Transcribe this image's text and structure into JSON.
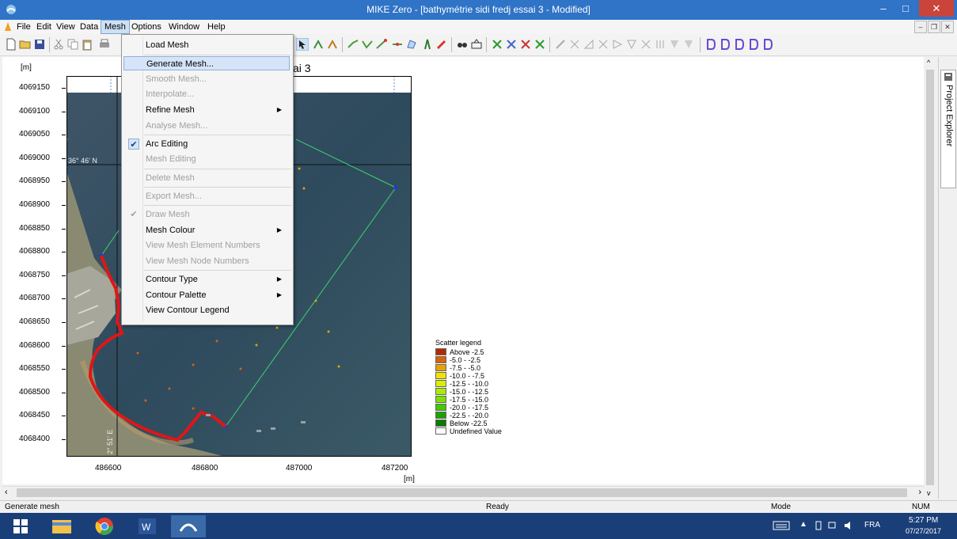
{
  "window": {
    "title": "MIKE Zero - [bathymétrie sidi fredj essai 3 - Modified]",
    "controls": {
      "minimize": "–",
      "maximize": "□",
      "close": "✕"
    }
  },
  "menubar": {
    "items": [
      "File",
      "Edit",
      "View",
      "Data",
      "Mesh",
      "Options",
      "Window",
      "Help"
    ],
    "active": "Mesh",
    "mdi": {
      "minimize": "–",
      "restore": "❐",
      "close": "✕"
    }
  },
  "mesh_menu": {
    "items": [
      {
        "label": "Load Mesh",
        "enabled": true
      },
      {
        "label": "Generate Mesh...",
        "enabled": true,
        "highlighted": true
      },
      {
        "label": "Smooth Mesh...",
        "enabled": false
      },
      {
        "label": "Interpolate...",
        "enabled": false
      },
      {
        "label": "Refine Mesh",
        "enabled": true,
        "submenu": true
      },
      {
        "label": "Analyse Mesh...",
        "enabled": false
      },
      {
        "label": "Arc Editing",
        "enabled": true,
        "checked": true
      },
      {
        "label": "Mesh Editing",
        "enabled": false
      },
      {
        "label": "Delete Mesh",
        "enabled": false
      },
      {
        "label": "Export Mesh...",
        "enabled": false
      },
      {
        "label": "Draw Mesh",
        "enabled": false,
        "checked": true
      },
      {
        "label": "Mesh Colour",
        "enabled": true,
        "submenu": true
      },
      {
        "label": "View Mesh Element Numbers",
        "enabled": false
      },
      {
        "label": "View Mesh Node Numbers",
        "enabled": false
      },
      {
        "label": "Contour Type",
        "enabled": true,
        "submenu": true
      },
      {
        "label": "Contour Palette",
        "enabled": true,
        "submenu": true
      },
      {
        "label": "View Contour Legend",
        "enabled": true
      }
    ]
  },
  "plot": {
    "title_fragment": "ai 3",
    "y_unit": "[m]",
    "x_unit": "[m]",
    "y_ticks": [
      "4069150",
      "4069100",
      "4069050",
      "4069000",
      "4068950",
      "4068900",
      "4068850",
      "4068800",
      "4068750",
      "4068700",
      "4068650",
      "4068600",
      "4068550",
      "4068500",
      "4068450",
      "4068400"
    ],
    "x_ticks": [
      "486600",
      "486800",
      "487000",
      "487200"
    ],
    "lat_label": "36° 46' N",
    "lon_label": "2° 51' E"
  },
  "legend": {
    "title": "Scatter legend",
    "entries": [
      {
        "label": "Above  -2.5",
        "color": "#b22a00"
      },
      {
        "label": "-5.0 -  -2.5",
        "color": "#d9620a"
      },
      {
        "label": "-7.5 -  -5.0",
        "color": "#e5a300"
      },
      {
        "label": "-10.0 -  -7.5",
        "color": "#f5e100"
      },
      {
        "label": "-12.5 - -10.0",
        "color": "#d8f000"
      },
      {
        "label": "-15.0 - -12.5",
        "color": "#a8ee00"
      },
      {
        "label": "-17.5 - -15.0",
        "color": "#7de000"
      },
      {
        "label": "-20.0 - -17.5",
        "color": "#45c800"
      },
      {
        "label": "-22.5 - -20.0",
        "color": "#1ea000"
      },
      {
        "label": "Below  -22.5",
        "color": "#0a7a00"
      },
      {
        "label": "Undefined Value",
        "color": "#ffffff"
      }
    ]
  },
  "side_panel": {
    "label": "Project Explorer"
  },
  "statusbar": {
    "left": "Generate mesh",
    "center": "Ready",
    "mode": "Mode",
    "num": "NUM"
  },
  "taskbar": {
    "lang": "FRA",
    "time": "5:27 PM",
    "date": "07/27/2017"
  },
  "colors": {
    "titlebar": "#2f74c6",
    "taskbar": "#1a3f78",
    "arc": "#3cd16b",
    "coast": "#e01616"
  }
}
